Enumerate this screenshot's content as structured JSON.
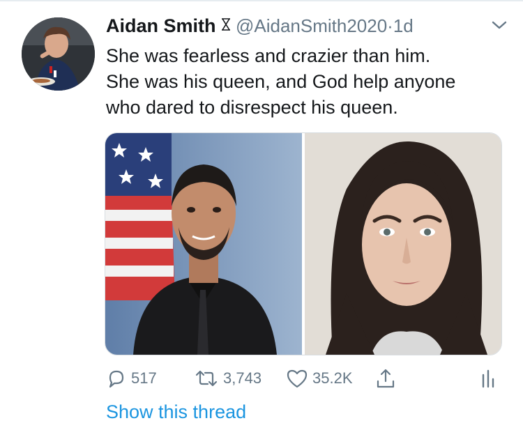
{
  "tweet": {
    "display_name": "Aidan Smith",
    "handle": "@AidanSmith2020",
    "separator": "·",
    "time": "1d",
    "text": "She was fearless and crazier than him.\nShe was his queen, and God help anyone\nwho dared to disrespect his queen.",
    "icons": {
      "name_badge": "hourglass-icon",
      "menu": "chevron-down-icon",
      "reply": "reply-icon",
      "retweet": "retweet-icon",
      "like": "heart-icon",
      "share": "share-icon",
      "analytics": "analytics-icon"
    },
    "stats": {
      "replies": "517",
      "retweets": "3,743",
      "likes": "35.2K"
    },
    "show_thread": "Show this thread"
  },
  "colors": {
    "text": "#14171a",
    "secondary": "#657786",
    "link": "#1b95e0"
  }
}
